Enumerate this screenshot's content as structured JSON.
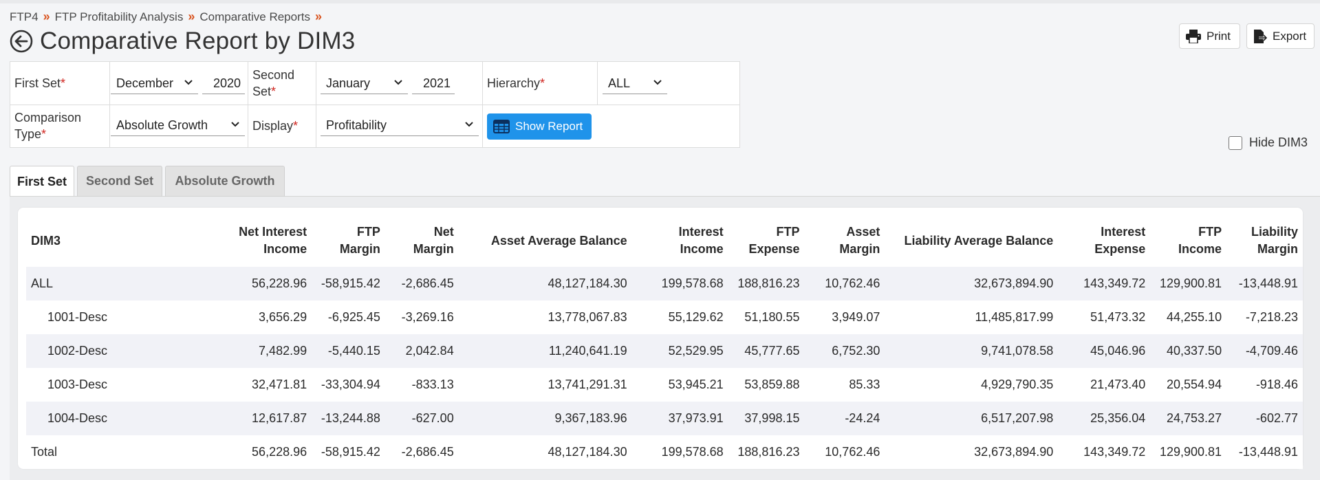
{
  "breadcrumb": [
    "FTP4",
    "FTP Profitability Analysis",
    "Comparative Reports"
  ],
  "page_title": "Comparative Report by DIM3",
  "actions": {
    "print": "Print",
    "export": "Export"
  },
  "filters": {
    "first_set": {
      "label": "First Set",
      "month": "December",
      "year": "2020"
    },
    "second_set": {
      "label_line1": "Second",
      "label_line2": "Set",
      "month": "January",
      "year": "2021"
    },
    "hierarchy": {
      "label": "Hierarchy",
      "value": "ALL"
    },
    "comparison_type": {
      "label_line1": "Comparison",
      "label_line2": "Type",
      "value": "Absolute Growth"
    },
    "display": {
      "label": "Display",
      "value": "Profitability"
    },
    "required_mark": "*",
    "show_report": "Show Report"
  },
  "hide_dim3": "Hide DIM3",
  "tabs": [
    "First Set",
    "Second Set",
    "Absolute Growth"
  ],
  "table": {
    "headers": [
      [
        "DIM3"
      ],
      [
        "Net Interest",
        "Income"
      ],
      [
        "FTP",
        "Margin"
      ],
      [
        "Net",
        "Margin"
      ],
      [
        "Asset Average Balance"
      ],
      [
        "Interest",
        "Income"
      ],
      [
        "FTP",
        "Expense"
      ],
      [
        "Asset",
        "Margin"
      ],
      [
        "Liability Average Balance"
      ],
      [
        "Interest",
        "Expense"
      ],
      [
        "FTP",
        "Income"
      ],
      [
        "Liability",
        "Margin"
      ]
    ],
    "rows": [
      [
        "ALL",
        "56,228.96",
        "-58,915.42",
        "-2,686.45",
        "48,127,184.30",
        "199,578.68",
        "188,816.23",
        "10,762.46",
        "32,673,894.90",
        "143,349.72",
        "129,900.81",
        "-13,448.91"
      ],
      [
        "1001-Desc",
        "3,656.29",
        "-6,925.45",
        "-3,269.16",
        "13,778,067.83",
        "55,129.62",
        "51,180.55",
        "3,949.07",
        "11,485,817.99",
        "51,473.32",
        "44,255.10",
        "-7,218.23"
      ],
      [
        "1002-Desc",
        "7,482.99",
        "-5,440.15",
        "2,042.84",
        "11,240,641.19",
        "52,529.95",
        "45,777.65",
        "6,752.30",
        "9,741,078.58",
        "45,046.96",
        "40,337.50",
        "-4,709.46"
      ],
      [
        "1003-Desc",
        "32,471.81",
        "-33,304.94",
        "-833.13",
        "13,741,291.31",
        "53,945.21",
        "53,859.88",
        "85.33",
        "4,929,790.35",
        "21,473.40",
        "20,554.94",
        "-918.46"
      ],
      [
        "1004-Desc",
        "12,617.87",
        "-13,244.88",
        "-627.00",
        "9,367,183.96",
        "37,973.91",
        "37,998.15",
        "-24.24",
        "6,517,207.98",
        "25,356.04",
        "24,753.27",
        "-602.77"
      ],
      [
        "Total",
        "56,228.96",
        "-58,915.42",
        "-2,686.45",
        "48,127,184.30",
        "199,578.68",
        "188,816.23",
        "10,762.46",
        "32,673,894.90",
        "143,349.72",
        "129,900.81",
        "-13,448.91"
      ]
    ]
  }
}
